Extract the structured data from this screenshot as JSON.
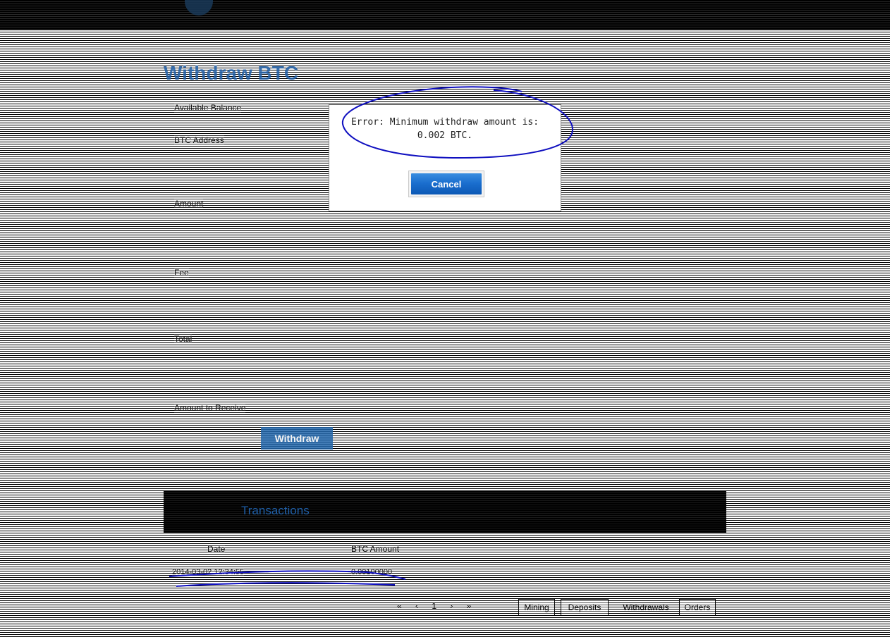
{
  "page": {
    "title": "Withdraw BTC",
    "field_label_1": "Available Balance",
    "field_label_2": "BTC Address",
    "field_label_3": "Amount",
    "field_label_4": "Fee",
    "field_label_5": "Total",
    "field_label_6": "Amount to Receive",
    "withdraw_label": "Withdraw"
  },
  "transactions": {
    "title": "Transactions",
    "columns": [
      "Date",
      "BTC Amount"
    ],
    "rows": [
      {
        "date": "2014-03-02 12:34:55",
        "amount": "0.00100000"
      }
    ],
    "pager": "« ‹ 1 › »"
  },
  "footer_tabs": [
    "Mining",
    "Deposits",
    "Withdrawals",
    "Orders"
  ],
  "dialog": {
    "message": "Error: Minimum withdraw amount is:\n0.002 BTC.",
    "cancel_label": "Cancel"
  },
  "colors": {
    "accent": "#1f5fa8",
    "button_blue": "#1b6fcf",
    "annotation": "#1010c0"
  }
}
